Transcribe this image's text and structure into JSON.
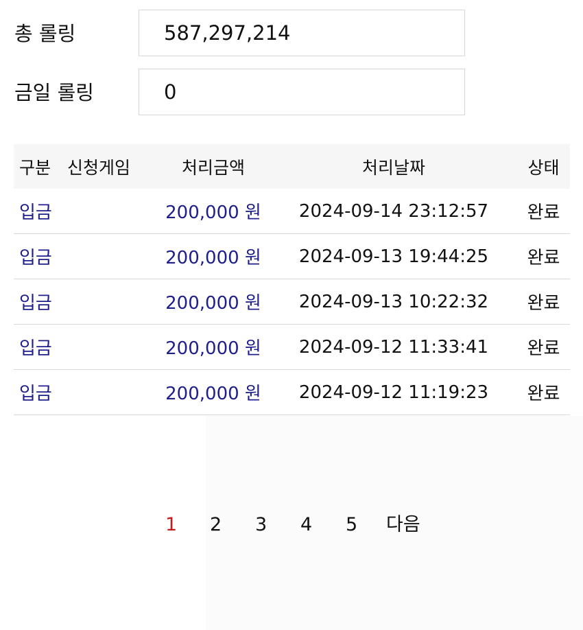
{
  "summary": {
    "total_rolling_label": "총 롤링",
    "total_rolling_value": "587,297,214",
    "today_rolling_label": "금일 롤링",
    "today_rolling_value": "0"
  },
  "table": {
    "headers": [
      "구분",
      "신청게임",
      "처리금액",
      "처리날짜",
      "상태"
    ],
    "rows": [
      {
        "type": "입금",
        "game": "",
        "amount": "200,000 원",
        "date": "2024-09-14 23:12:57",
        "status": "완료"
      },
      {
        "type": "입금",
        "game": "",
        "amount": "200,000 원",
        "date": "2024-09-13 19:44:25",
        "status": "완료"
      },
      {
        "type": "입금",
        "game": "",
        "amount": "200,000 원",
        "date": "2024-09-13 10:22:32",
        "status": "완료"
      },
      {
        "type": "입금",
        "game": "",
        "amount": "200,000 원",
        "date": "2024-09-12 11:33:41",
        "status": "완료"
      },
      {
        "type": "입금",
        "game": "",
        "amount": "200,000 원",
        "date": "2024-09-12 11:19:23",
        "status": "완료"
      }
    ]
  },
  "pagination": {
    "pages": [
      "1",
      "2",
      "3",
      "4",
      "5"
    ],
    "current_page": "1",
    "next_label": "다음"
  },
  "colors": {
    "type_amount_text": "#1f1f8c",
    "active_page": "#c41c1c",
    "header_bg": "#f6f6f6"
  }
}
